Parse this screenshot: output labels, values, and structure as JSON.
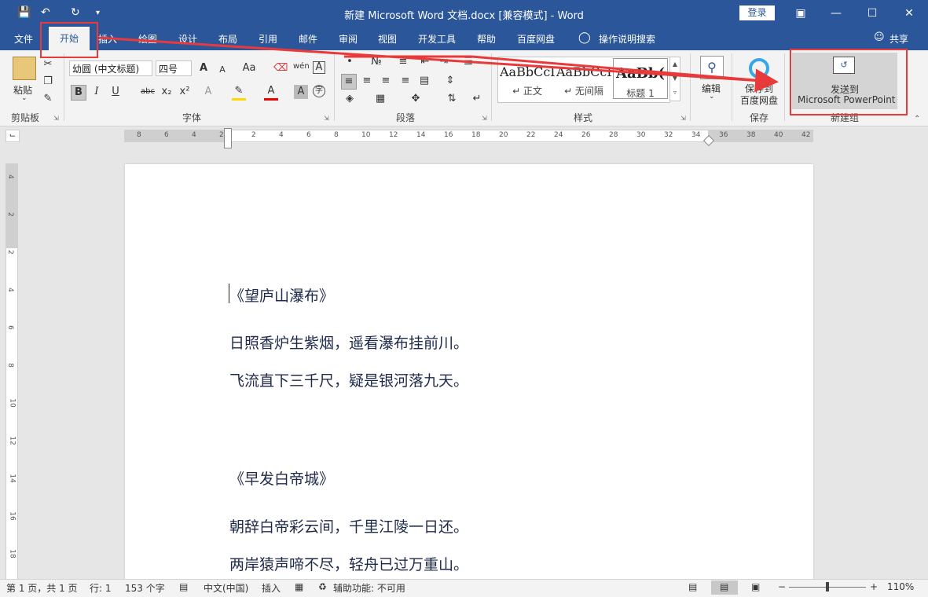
{
  "window": {
    "title": "新建 Microsoft Word 文档.docx [兼容模式]  -  Word",
    "login": "登录"
  },
  "tabs": [
    "文件",
    "开始",
    "插入",
    "绘图",
    "设计",
    "布局",
    "引用",
    "邮件",
    "审阅",
    "视图",
    "开发工具",
    "帮助",
    "百度网盘"
  ],
  "search": "操作说明搜索",
  "share": "共享",
  "ribbon": {
    "clipboard": {
      "paste": "粘贴",
      "label": "剪贴板"
    },
    "font": {
      "name": "幼圆 (中文标题)",
      "size": "四号",
      "label": "字体",
      "grow": "A",
      "shrink": "A",
      "case": "Aa",
      "wen": "wén",
      "bold": "B",
      "italic": "I",
      "underline": "U",
      "strike": "abc",
      "sub": "x₂",
      "sup": "x²"
    },
    "paragraph": {
      "label": "段落"
    },
    "styles": {
      "label": "样式",
      "items": [
        {
          "sample": "AaBbCcI",
          "name": "↵ 正文"
        },
        {
          "sample": "AaBbCcI",
          "name": "↵ 无间隔"
        },
        {
          "sample": "AaBb(",
          "name": "标题 1"
        }
      ]
    },
    "edit": {
      "label": "编辑"
    },
    "save": {
      "btn": "保存到\n百度网盘",
      "line1": "保存到",
      "line2": "百度网盘",
      "label": "保存"
    },
    "newgroup": {
      "line1": "发送到",
      "line2": "Microsoft PowerPoint",
      "label": "新建组"
    }
  },
  "ruler": {
    "h": [
      "8",
      "6",
      "4",
      "2",
      "2",
      "4",
      "6",
      "8",
      "10",
      "12",
      "14",
      "16",
      "18",
      "20",
      "22",
      "24",
      "26",
      "28",
      "30",
      "32",
      "34",
      "36",
      "38",
      "40",
      "42"
    ],
    "v": [
      "4",
      "2",
      "2",
      "4",
      "6",
      "8",
      "10",
      "12",
      "14",
      "16",
      "18"
    ]
  },
  "document": {
    "lines": [
      "《望庐山瀑布》",
      "日照香炉生紫烟，遥看瀑布挂前川。",
      "飞流直下三千尺，疑是银河落九天。",
      "《早发白帝城》",
      "朝辞白帝彩云间，千里江陵一日还。",
      "两岸猿声啼不尽，轻舟已过万重山。"
    ]
  },
  "status": {
    "page": "第 1 页，共 1 页",
    "row": "行: 1",
    "words": "153 个字",
    "lang": "中文(中国)",
    "insert": "插入",
    "access": "辅助功能: 不可用",
    "zoom": "110%",
    "zoom_minus": "−",
    "zoom_plus": "+"
  },
  "colors": {
    "accent": "#2b579a",
    "annotation": "#e83a3a"
  }
}
